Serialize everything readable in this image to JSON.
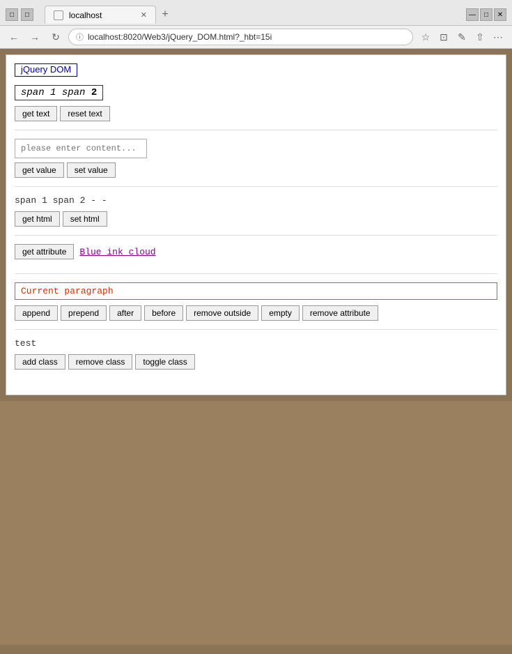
{
  "browser": {
    "title": "localhost",
    "url": "localhost:8020/Web3/jQuery_DOM.html?_hbt=15i",
    "tab_label": "localhost"
  },
  "page": {
    "title": "jQuery DOM",
    "sections": {
      "text_section": {
        "span_text": "span ",
        "span_italic": "1",
        "span_text2": " span ",
        "span_bold": "2",
        "get_text_btn": "get text",
        "reset_text_btn": "reset text",
        "input_placeholder": "please enter content..."
      },
      "value_section": {
        "get_value_btn": "get value",
        "set_value_btn": "set value"
      },
      "html_section": {
        "text": "span 1 span 2 - -",
        "get_html_btn": "get html",
        "set_html_btn": "set html"
      },
      "attr_section": {
        "get_attr_btn": "get attribute",
        "link_text": "Blue ink cloud"
      },
      "dom_section": {
        "paragraph": "Current paragraph",
        "append_btn": "append",
        "prepend_btn": "prepend",
        "after_btn": "after",
        "before_btn": "before",
        "remove_outside_btn": "remove outside",
        "empty_btn": "empty",
        "remove_attribute_btn": "remove attribute"
      },
      "class_section": {
        "test_text": "test",
        "add_class_btn": "add class",
        "remove_class_btn": "remove class",
        "toggle_class_btn": "toggle class"
      }
    }
  }
}
